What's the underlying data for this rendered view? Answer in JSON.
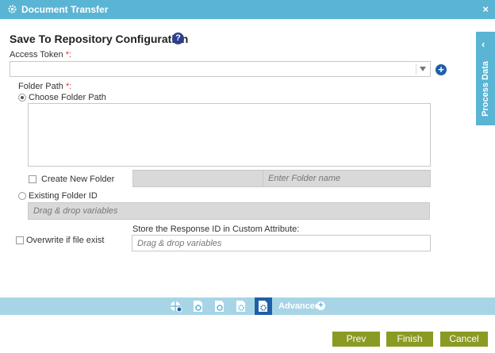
{
  "window": {
    "title": "Document Transfer",
    "close_label": "×"
  },
  "form": {
    "heading": "Save To Repository Configuration",
    "help_label": "?",
    "access_token": {
      "label": "Access Token",
      "required_mark": "*:",
      "value": ""
    },
    "add_label": "+",
    "folder_path": {
      "label": "Folder Path",
      "required_mark": "*:",
      "choose_label": "Choose Folder Path",
      "create_new_label": "Create New Folder",
      "folder_name_placeholder": "Enter Folder name",
      "existing_label": "Existing Folder ID",
      "existing_placeholder": "Drag & drop variables"
    },
    "overwrite_label": "Overwrite if file exist",
    "response_id": {
      "label": "Store the Response ID in Custom Attribute:",
      "placeholder": "Drag & drop variables"
    }
  },
  "side_panel": {
    "label": "Process Data",
    "chevron": "‹"
  },
  "toolbar": {
    "icons": [
      "globe-settings-icon",
      "document-settings-icon",
      "document-settings-icon",
      "document-gear-icon",
      "document-gear-active-icon"
    ],
    "advanced_label": "Advanced",
    "advanced_plus": "+"
  },
  "buttons": {
    "prev": "Prev",
    "finish": "Finish",
    "cancel": "Cancel"
  },
  "colors": {
    "header": "#5ab4d4",
    "toolbar": "#a8d5e6",
    "button": "#8b9a23",
    "accent": "#1f5fa8",
    "required": "#e03030"
  }
}
